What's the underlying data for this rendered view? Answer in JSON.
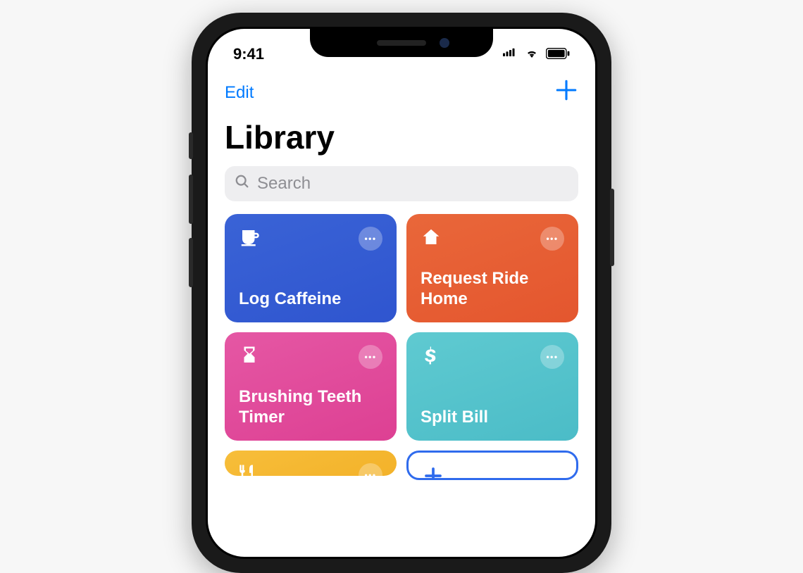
{
  "statusbar": {
    "time": "9:41"
  },
  "navbar": {
    "edit_label": "Edit"
  },
  "page": {
    "title": "Library"
  },
  "search": {
    "placeholder": "Search"
  },
  "cards": [
    {
      "label": "Log Caffeine",
      "icon": "cup",
      "color": "blue"
    },
    {
      "label": "Request Ride Home",
      "icon": "home",
      "color": "orange"
    },
    {
      "label": "Brushing Teeth Timer",
      "icon": "hourglass",
      "color": "pink"
    },
    {
      "label": "Split Bill",
      "icon": "dollar",
      "color": "teal"
    },
    {
      "label": "",
      "icon": "utensils",
      "color": "yellow"
    },
    {
      "label": "",
      "icon": "plus",
      "color": "outline"
    }
  ],
  "colors": {
    "accent": "#007aff",
    "blue": "#2f55cf",
    "orange": "#e4562e",
    "pink": "#dd4093",
    "teal": "#4bbcc7",
    "yellow": "#f3b22a"
  }
}
